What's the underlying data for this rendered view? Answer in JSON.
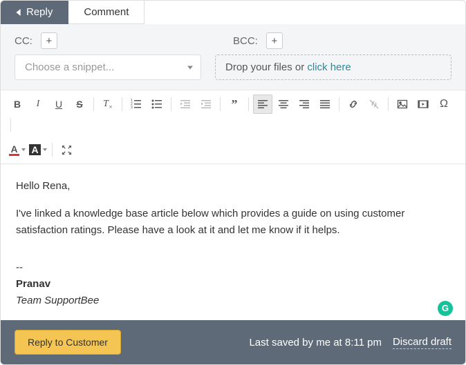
{
  "tabs": {
    "reply": "Reply",
    "comment": "Comment"
  },
  "recipients": {
    "cc_label": "CC:",
    "bcc_label": "BCC:"
  },
  "snippet": {
    "placeholder": "Choose a snippet..."
  },
  "dropzone": {
    "text": "Drop your files or ",
    "link": "click here"
  },
  "message": {
    "greeting": "Hello Rena,",
    "body": "I've linked a knowledge base article below which provides a guide on using customer satisfaction ratings. Please have a look at it and let me know if it helps.",
    "sig_sep": "--",
    "sig_name": "Pranav",
    "sig_team": "Team SupportBee"
  },
  "footer": {
    "reply_button": "Reply to Customer",
    "saved": "Last saved by me at 8:11 pm",
    "discard": "Discard draft"
  },
  "grammarly": "G"
}
